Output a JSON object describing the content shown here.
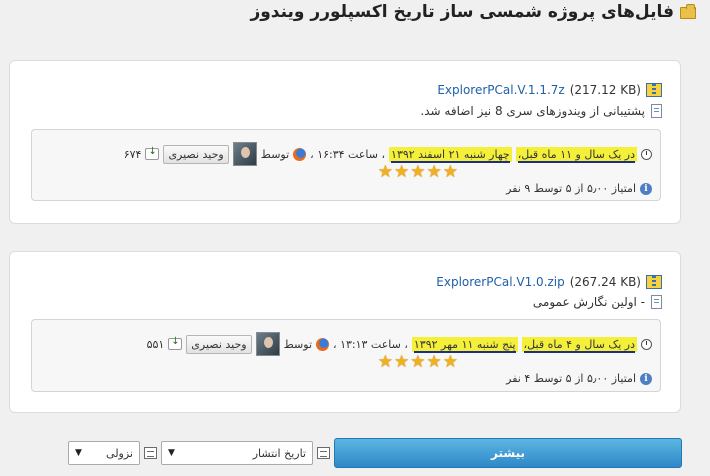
{
  "page_title": "فایل‌های پروژه شمسی ساز تاریخ اکسپلورر ویندوز",
  "files": [
    {
      "name": "ExplorerPCal.V.1.1.7z",
      "size": "(217.12 KB)",
      "description": "پشتیبانی از ویندوزهای سری 8 نیز اضافه شد.",
      "age_text": "در یک سال و ۱۱ ماه قبل،",
      "date_text": "چهار شنبه ۲۱ اسفند ۱۳۹۲",
      "time_text": "، ساعت ۱۶:۳۴ ،",
      "by_label": "توسط",
      "uploader": "وحید نصیری",
      "downloads": "۶۷۴",
      "rating_text": "امتیاز ۵٫۰۰ از ۵ توسط ۹ نفر",
      "stars": 5
    },
    {
      "name": "ExplorerPCal.V1.0.zip",
      "size": "(267.24 KB)",
      "description": "- اولین نگارش عمومی",
      "age_text": "در یک سال و ۴ ماه قبل،",
      "date_text": "پنج شنبه ۱۱ مهر ۱۳۹۲",
      "time_text": "، ساعت ۱۳:۱۳ ،",
      "by_label": "توسط",
      "uploader": "وحید نصیری",
      "downloads": "۵۵۱",
      "rating_text": "امتیاز ۵٫۰۰ از ۵ توسط ۴ نفر",
      "stars": 5
    }
  ],
  "bottom": {
    "more_label": "بیشتر",
    "sort_field": "تاریخ انتشار",
    "sort_order": "نزولی"
  },
  "colors": {
    "highlight": "#f4f03a",
    "link": "#1f5fa8",
    "button_blue": "#2f88c7",
    "star": "#f2b01e"
  },
  "icons": [
    "folder-icon",
    "zip-icon",
    "document-icon",
    "clock-icon",
    "firefox-icon",
    "download-icon",
    "info-icon",
    "sort-icon",
    "star-icon"
  ]
}
